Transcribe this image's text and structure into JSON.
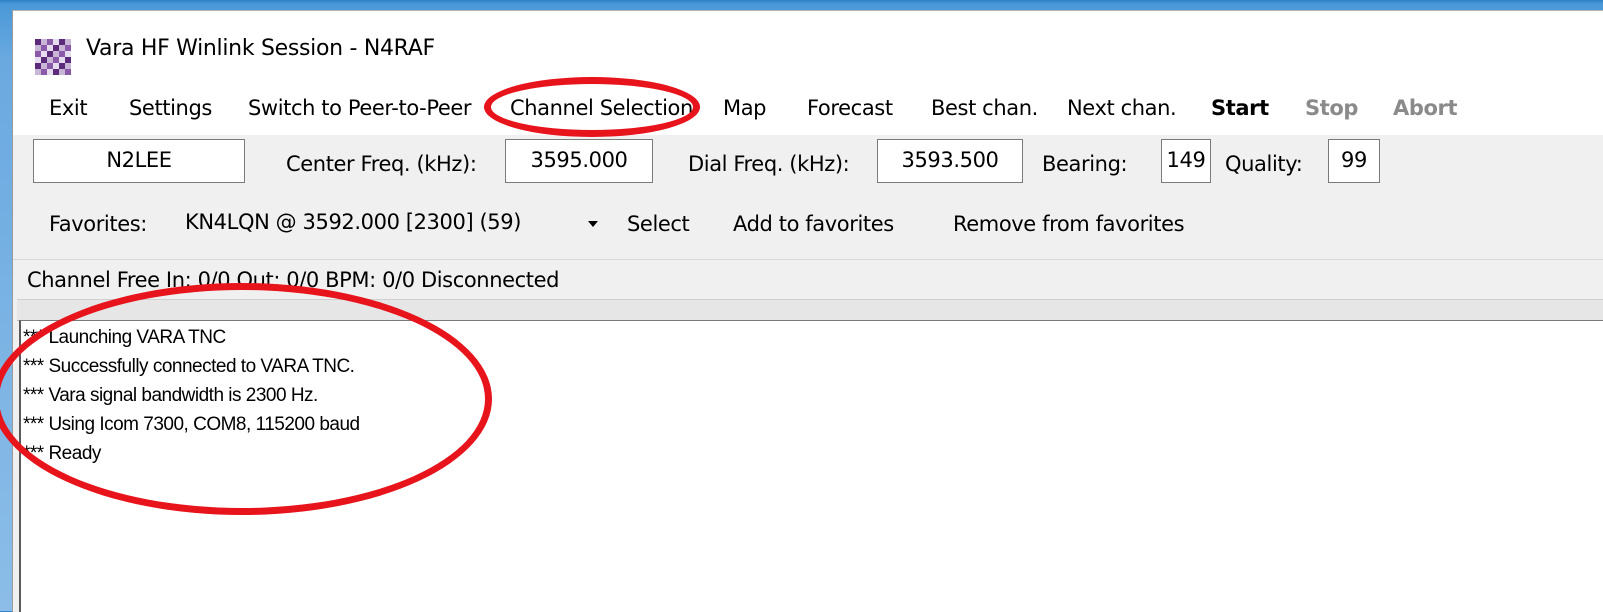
{
  "window": {
    "title": "Vara HF Winlink Session - N4RAF",
    "icon": "checkerboard-app-icon"
  },
  "menu": {
    "exit": "Exit",
    "settings": "Settings",
    "switch_p2p": "Switch to Peer-to-Peer",
    "channel_selection": "Channel Selection",
    "map": "Map",
    "forecast": "Forecast",
    "best_chan": "Best chan.",
    "next_chan": "Next chan.",
    "start": "Start",
    "stop": "Stop",
    "abort": "Abort"
  },
  "station": {
    "callsign": "N2LEE",
    "center_freq_label": "Center Freq. (kHz):",
    "center_freq": "3595.000",
    "dial_freq_label": "Dial Freq. (kHz):",
    "dial_freq": "3593.500",
    "bearing_label": "Bearing:",
    "bearing": "149",
    "quality_label": "Quality:",
    "quality": "99"
  },
  "favorites": {
    "label": "Favorites:",
    "selected": "KN4LQN  @  3592.000 [2300]  (59)",
    "select": "Select",
    "add": "Add to favorites",
    "remove": "Remove from favorites"
  },
  "status": "Channel Free  In: 0/0  Out: 0/0  BPM: 0/0  Disconnected",
  "log": [
    "*** Launching VARA TNC",
    "*** Successfully connected to VARA TNC.",
    "*** Vara signal bandwidth is 2300 Hz.",
    "*** Using Icom 7300, COM8, 115200 baud",
    "*** Ready"
  ],
  "colors": {
    "annotation": "#e8141c",
    "icon_purple": "#5b2a7a",
    "disabled_text": "#8a8a8a"
  }
}
